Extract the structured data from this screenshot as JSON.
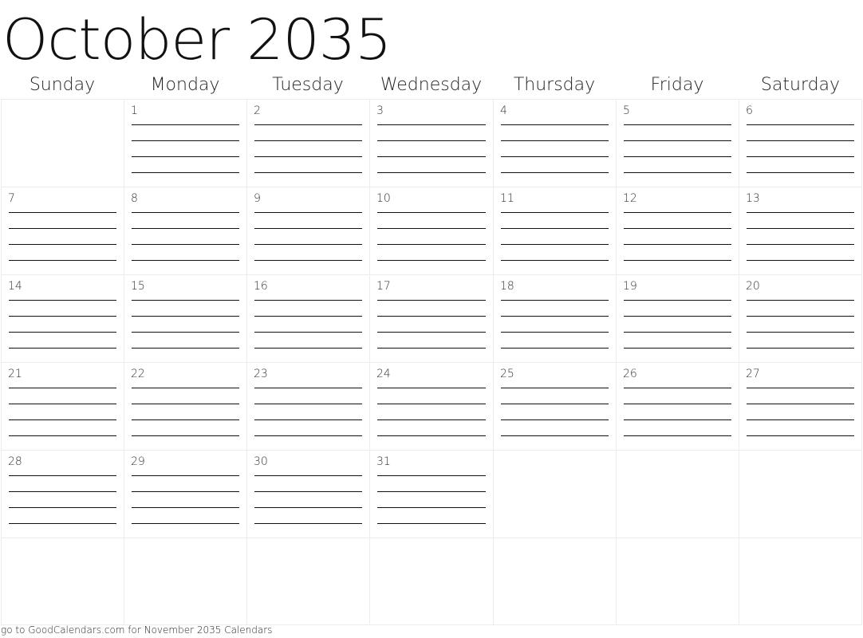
{
  "title": "October 2035",
  "weekdays": [
    "Sunday",
    "Monday",
    "Tuesday",
    "Wednesday",
    "Thursday",
    "Friday",
    "Saturday"
  ],
  "weeks": [
    [
      "",
      "1",
      "2",
      "3",
      "4",
      "5",
      "6"
    ],
    [
      "7",
      "8",
      "9",
      "10",
      "11",
      "12",
      "13"
    ],
    [
      "14",
      "15",
      "16",
      "17",
      "18",
      "19",
      "20"
    ],
    [
      "21",
      "22",
      "23",
      "24",
      "25",
      "26",
      "27"
    ],
    [
      "28",
      "29",
      "30",
      "31",
      "",
      "",
      ""
    ],
    [
      "",
      "",
      "",
      "",
      "",
      "",
      ""
    ]
  ],
  "writing_lines_per_day": 4,
  "footer": "go to GoodCalendars.com for November 2035 Calendars"
}
